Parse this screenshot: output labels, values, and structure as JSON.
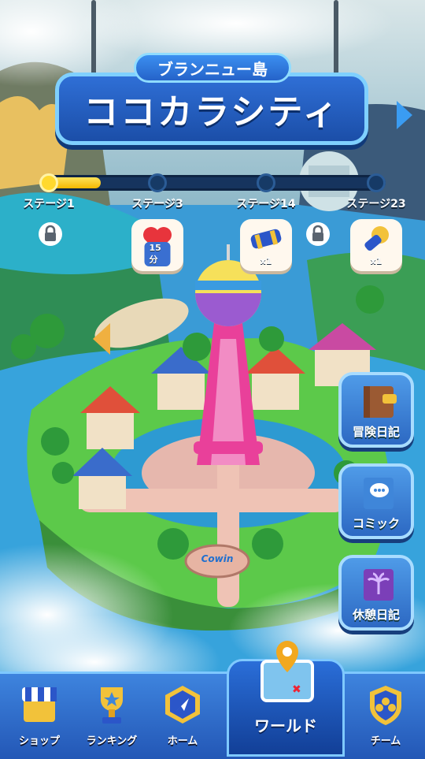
{
  "header": {
    "island_name": "ブランニュー島",
    "city_name": "ココカラシティ"
  },
  "progress": {
    "fill_fraction": 0.17,
    "stages": [
      {
        "label": "ステージ1",
        "reward": "lock"
      },
      {
        "label": "ステージ3",
        "reward": "heart",
        "reward_text": "15分"
      },
      {
        "label": "ステージ14",
        "reward": "hammer",
        "reward_text": "x1",
        "extra": "lock"
      },
      {
        "label": "ステージ23",
        "reward": "rocket",
        "reward_text": "x1"
      }
    ]
  },
  "side_menu": {
    "adventure_diary": "冒険日記",
    "comic": "コミック",
    "rest_diary": "休憩日記"
  },
  "sign": {
    "text": "Cowin"
  },
  "bottom_nav": {
    "shop": "ショップ",
    "ranking": "ランキング",
    "home": "ホーム",
    "world": "ワールド",
    "team": "チーム"
  },
  "colors": {
    "sea": "#2f8ec9",
    "grass": "#5cc94a",
    "accent_blue": "#2f6fd6",
    "progress_yellow": "#ffd92e"
  }
}
